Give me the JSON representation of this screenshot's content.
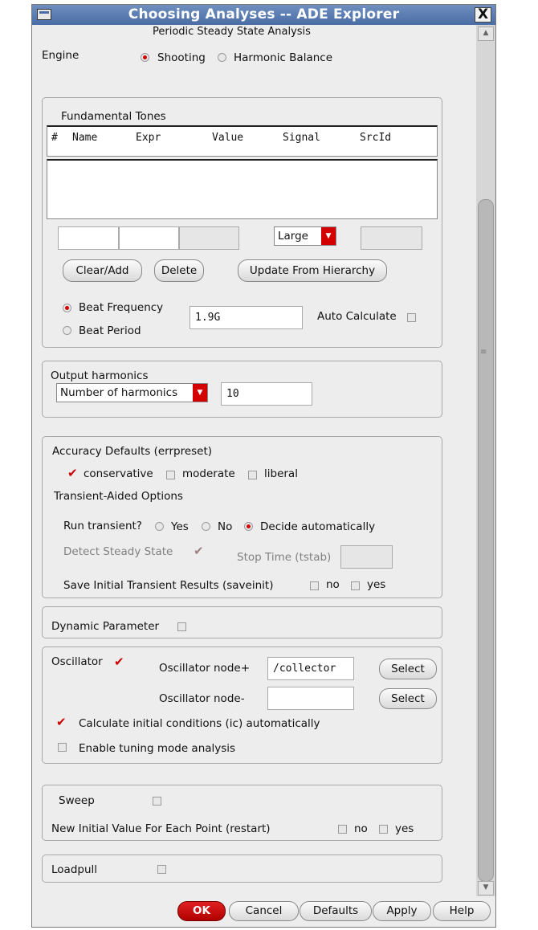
{
  "window": {
    "title": "Choosing Analyses -- ADE Explorer",
    "close_symbol": "X"
  },
  "analysis_title": "Periodic Steady State Analysis",
  "engine": {
    "label": "Engine",
    "options": [
      "Shooting",
      "Harmonic Balance"
    ],
    "selected": "Shooting"
  },
  "fundamental_tones": {
    "title": "Fundamental Tones",
    "columns": [
      "#",
      "Name",
      "Expr",
      "Value",
      "Signal",
      "SrcId"
    ],
    "signal_select": "Large",
    "buttons": {
      "clear_add": "Clear/Add",
      "delete": "Delete",
      "update": "Update From Hierarchy"
    },
    "beat_frequency_label": "Beat Frequency",
    "beat_period_label": "Beat Period",
    "beat_selected": "Beat Frequency",
    "beat_value": "1.9G",
    "auto_calculate_label": "Auto Calculate"
  },
  "output_harmonics": {
    "title": "Output harmonics",
    "mode": "Number of harmonics",
    "value": "10"
  },
  "accuracy": {
    "title": "Accuracy Defaults (errpreset)",
    "options": [
      "conservative",
      "moderate",
      "liberal"
    ],
    "selected": "conservative",
    "transient_title": "Transient-Aided Options",
    "run_transient_label": "Run transient?",
    "run_options": [
      "Yes",
      "No",
      "Decide automatically"
    ],
    "run_selected": "Decide automatically",
    "detect_label": "Detect Steady State",
    "stop_time_label": "Stop Time (tstab)",
    "save_label": "Save Initial Transient Results (saveinit)",
    "no": "no",
    "yes": "yes"
  },
  "dynamic_parameter": {
    "label": "Dynamic Parameter"
  },
  "oscillator": {
    "label": "Oscillator",
    "node_plus_label": "Oscillator node+",
    "node_plus_value": "/collector",
    "node_minus_label": "Oscillator node-",
    "node_minus_value": "",
    "select_label": "Select",
    "calc_ic_label": "Calculate initial conditions (ic) automatically",
    "tuning_label": "Enable tuning mode analysis"
  },
  "sweep": {
    "label": "Sweep",
    "restart_label": "New Initial Value For Each Point (restart)",
    "no": "no",
    "yes": "yes"
  },
  "loadpull": {
    "label": "Loadpull"
  },
  "footer": {
    "ok": "OK",
    "cancel": "Cancel",
    "defaults": "Defaults",
    "apply": "Apply",
    "help": "Help"
  },
  "colors": {
    "accent": "#cc0000",
    "titlebar": "#4a6da6",
    "panel": "#ededed"
  }
}
